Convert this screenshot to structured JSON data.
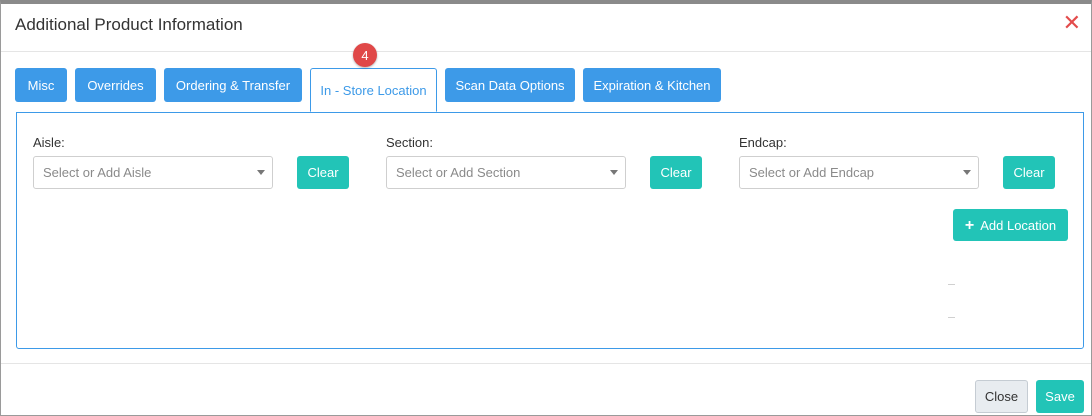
{
  "modal": {
    "title": "Additional Product Information",
    "close_glyph": "✕"
  },
  "tabs": [
    {
      "label": "Misc",
      "active": false
    },
    {
      "label": "Overrides",
      "active": false
    },
    {
      "label": "Ordering & Transfer",
      "active": false
    },
    {
      "label": "In - Store Location",
      "active": true
    },
    {
      "label": "Scan Data Options",
      "active": false
    },
    {
      "label": "Expiration & Kitchen",
      "active": false
    }
  ],
  "step_badge": "4",
  "fields": {
    "aisle": {
      "label": "Aisle:",
      "placeholder": "Select or Add Aisle",
      "clear_label": "Clear"
    },
    "section": {
      "label": "Section:",
      "placeholder": "Select or Add Section",
      "clear_label": "Clear"
    },
    "endcap": {
      "label": "Endcap:",
      "placeholder": "Select or Add Endcap",
      "clear_label": "Clear"
    }
  },
  "add_location": {
    "icon": "plus-icon",
    "label": "Add Location"
  },
  "footer": {
    "close_label": "Close",
    "save_label": "Save"
  },
  "colors": {
    "tab_blue": "#3d9ae8",
    "teal": "#22c4b7",
    "badge_red": "#e04848",
    "close_red": "#e34b4b"
  }
}
